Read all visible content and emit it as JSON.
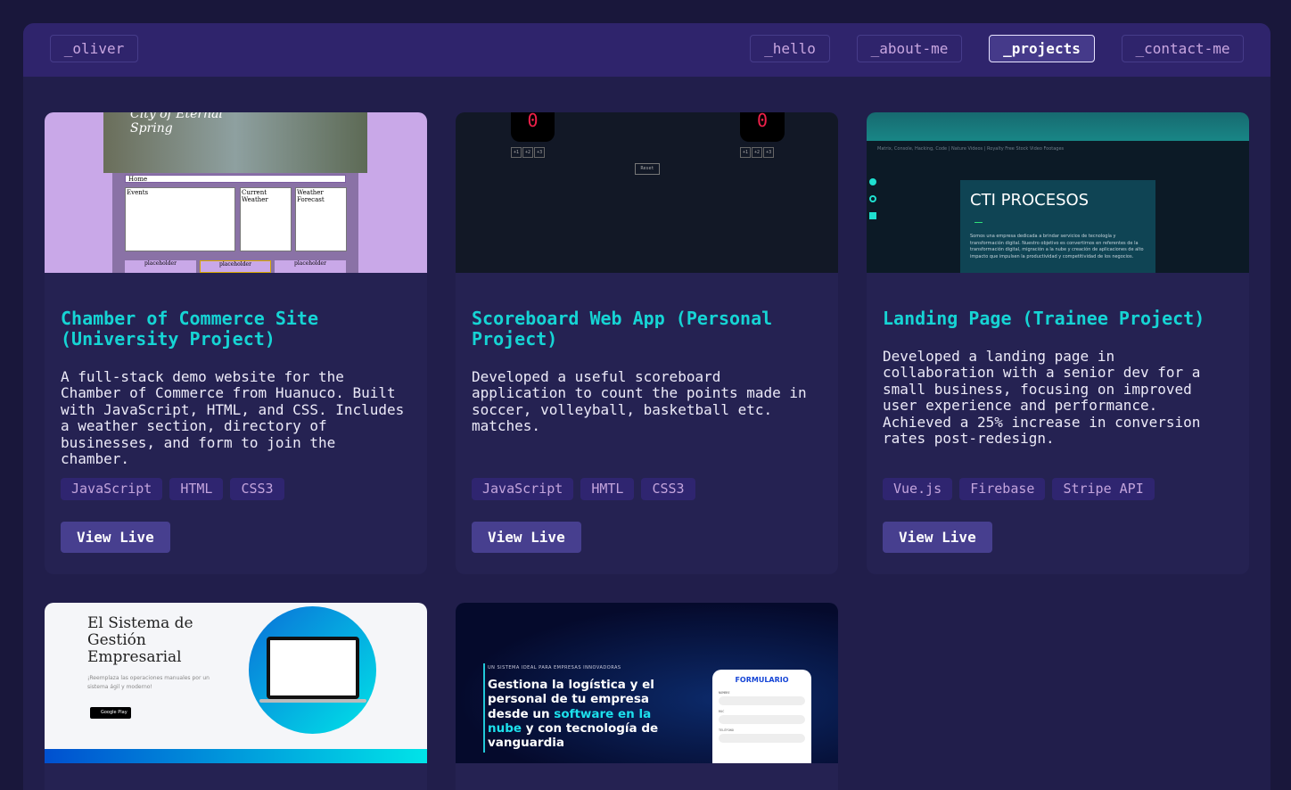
{
  "header": {
    "logo": "_oliver",
    "nav": [
      "_hello",
      "_about-me",
      "_projects",
      "_contact-me"
    ],
    "active": "_projects"
  },
  "projects": [
    {
      "title": "Chamber of Commerce Site (University Project)",
      "description": "A full-stack demo website for the Chamber of Commerce from Huanuco. Built with JavaScript, HTML, and CSS. Includes a weather section, directory of businesses, and form to join the chamber.",
      "tags": [
        "JavaScript",
        "HTML",
        "CSS3"
      ],
      "button": "View Live",
      "thumb": {
        "heading": "City of Eternal Spring",
        "nav": "Home",
        "panels": [
          "Events",
          "Current Weather",
          "Weather Forecast"
        ],
        "footer": [
          "placeholder",
          "placeholder",
          "placeholder"
        ]
      }
    },
    {
      "title": "Scoreboard Web App (Personal Project)",
      "description": "Developed a useful scoreboard application to count the points made in soccer, volleyball, basketball etc. matches.",
      "tags": [
        "JavaScript",
        "HMTL",
        "CSS3"
      ],
      "button": "View Live",
      "thumb": {
        "score_left": "0",
        "score_right": "0",
        "increments": [
          "+1",
          "+2",
          "+3"
        ],
        "reset": "Reset"
      }
    },
    {
      "title": "Landing Page (Trainee Project)",
      "description": "Developed a landing page in collaboration with a senior dev for a small business, focusing on improved user experience and performance. Achieved a 25% increase in conversion rates post-redesign.",
      "tags": [
        "Vue.js",
        "Firebase",
        "Stripe API"
      ],
      "button": "View Live",
      "thumb": {
        "video_title": "Matrix, Console, Hacking, Code | Nature Videos | Royalty Free Stock Video Footages",
        "heading": "CTI PROCESOS",
        "text": "Somos una empresa dedicada a brindar servicios de tecnología y transformación digital. Nuestro objetivo es convertirnos en referentes de la transformación digital, migración a la nube y creación de aplicaciones de alto impacto que impulsen la productividad y competitividad de los negocios."
      }
    },
    {
      "thumb": {
        "heading": "El Sistema de Gestión Empresarial",
        "sub": "¡Reemplaza las operaciones manuales por un sistema ágil y moderno!",
        "badge": "Google Play"
      }
    },
    {
      "thumb": {
        "eyebrow": "UN SISTEMA IDEAL PARA EMPRESAS INNOVADORAS",
        "headline_a": "Gestiona la logística y el personal de tu empresa desde un ",
        "headline_hl": "software en la nube",
        "headline_b": " y con tecnología de vanguardia",
        "form_title": "FORMULARIO",
        "fields": [
          "NOMBRE",
          "RUC",
          "TELÉFONO"
        ]
      }
    }
  ],
  "colors": {
    "accent": "#16d4d4",
    "header": "#2f246c",
    "card": "#252252",
    "button": "#473f8f"
  }
}
